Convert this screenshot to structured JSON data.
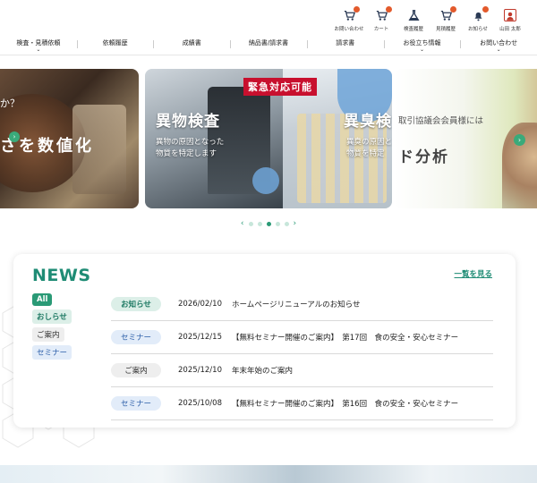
{
  "header": {
    "utility": [
      {
        "name": "contact",
        "label": "お問い合わせ",
        "icon": "cart-icon",
        "badge": true
      },
      {
        "name": "cart",
        "label": "カート",
        "icon": "cart-icon",
        "badge": true
      },
      {
        "name": "history",
        "label": "検査履歴",
        "icon": "flask-icon",
        "badge": false
      },
      {
        "name": "quote",
        "label": "見積履歴",
        "icon": "cart-icon",
        "badge": true
      },
      {
        "name": "notice",
        "label": "お知らせ",
        "icon": "bell-icon",
        "badge": true
      },
      {
        "name": "user",
        "label": "山田 太郎",
        "icon": "user-icon",
        "badge": false
      }
    ]
  },
  "nav": [
    {
      "label": "検査・見積依頼",
      "chevron": true
    },
    {
      "label": "依頼履歴",
      "chevron": false
    },
    {
      "label": "成績書",
      "chevron": false
    },
    {
      "label": "納品書/請求書",
      "chevron": false
    },
    {
      "label": "請求書",
      "chevron": false
    },
    {
      "label": "お役立ち情報",
      "chevron": true
    },
    {
      "label": "お問い合わせ",
      "chevron": true
    }
  ],
  "carousel": {
    "slide1": {
      "question": "か？",
      "big": "さを数値化"
    },
    "slide2": {
      "badge": "緊急対応可能",
      "left_title": "異物検査",
      "left_desc1": "異物の原因となった",
      "left_desc2": "物質を特定します",
      "right_title": "異臭検",
      "right_desc1": "異臭の原因と",
      "right_desc2": "物質を特定"
    },
    "slide3": {
      "line1": "取引協議会会員様には",
      "line2": "ド分析"
    },
    "dots": 5,
    "active_dot": 3
  },
  "news": {
    "title": "NEWS",
    "see_all": "一覧を見る",
    "filters": [
      {
        "label": "All",
        "kind": "all"
      },
      {
        "label": "おしらせ",
        "kind": "info"
      },
      {
        "label": "ご案内",
        "kind": "guide"
      },
      {
        "label": "セミナー",
        "kind": "sem"
      }
    ],
    "items": [
      {
        "category": "お知らせ",
        "kind": "info",
        "date": "2026/02/10",
        "text": "ホームページリニューアルのお知らせ"
      },
      {
        "category": "セミナー",
        "kind": "sem",
        "date": "2025/12/15",
        "text": "【無料セミナー開催のご案内】　第17回　食の安全・安心セミナー"
      },
      {
        "category": "ご案内",
        "kind": "guide",
        "date": "2025/12/10",
        "text": "年末年始のご案内"
      },
      {
        "category": "セミナー",
        "kind": "sem",
        "date": "2025/10/08",
        "text": "【無料セミナー開催のご案内】　第16回　食の安全・安心セミナー"
      }
    ]
  },
  "colors": {
    "accent": "#2a9a76",
    "badge": "#e35a2c",
    "urgent": "#c8102e"
  }
}
